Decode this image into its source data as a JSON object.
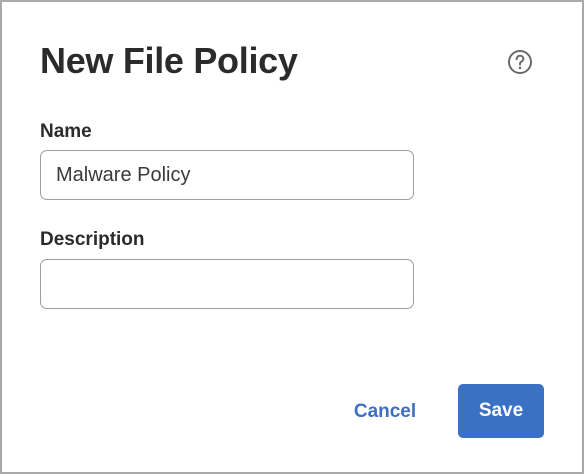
{
  "dialog": {
    "title": "New File Policy",
    "help_icon": "question-circle-icon"
  },
  "form": {
    "name_label": "Name",
    "name_value": "Malware Policy",
    "name_placeholder": "",
    "description_label": "Description",
    "description_value": "",
    "description_placeholder": ""
  },
  "actions": {
    "cancel_label": "Cancel",
    "save_label": "Save"
  },
  "colors": {
    "accent": "#3b71c5",
    "link": "#3f6fc4",
    "text": "#2b2b2b",
    "backdrop": "#a9a9a9"
  }
}
